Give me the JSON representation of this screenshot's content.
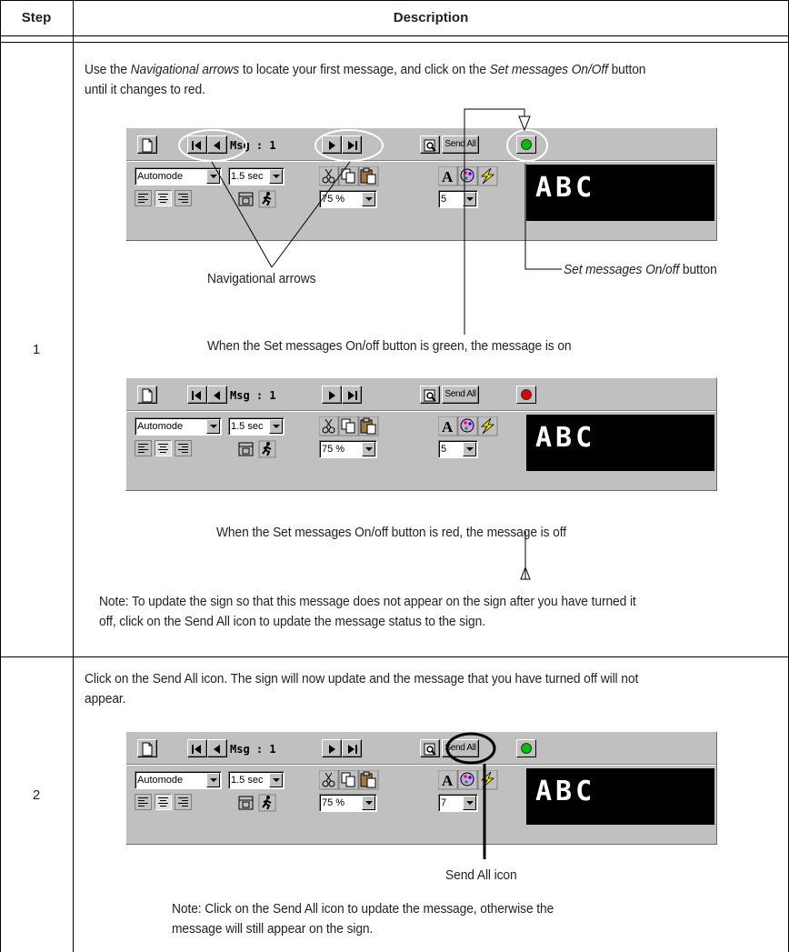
{
  "table": {
    "col_step": "Step",
    "col_description": "Description"
  },
  "step1": {
    "number": "1",
    "intro_prefix": "Use the ",
    "intro_nav": "Navigational arrows",
    "intro_mid": " to locate your first message, and click on the ",
    "intro_btn": "Set messages On/Off",
    "intro_suffix": " button",
    "intro_line2": "until it changes to red.",
    "callout_nav": "Navigational arrows",
    "callout_btn_italic": "Set messages On/off",
    "callout_btn_rest": " button",
    "caption_green": "When the Set messages On/off button is green, the message is on",
    "caption_red": "When the Set messages On/off button is red, the message is off",
    "note_line1": "Note: To update the sign so that this message does not appear on the sign after you have turned it",
    "note_line2": "off, click on the Send All icon to update the message status to the sign."
  },
  "step2": {
    "number": "2",
    "intro_line1": "Click on the Send All icon. The sign will now update and the message that you have turned off will not",
    "intro_line2": "appear.",
    "callout_send": "Send All icon",
    "note_line1": "Note: Click on the Send All icon to update the message, otherwise the",
    "note_line2": "message will still appear on the sign."
  },
  "toolbars": [
    {
      "msg_label": "Msg : 1",
      "send_all": "Send All",
      "led_color": "#00c000",
      "mode": "Automode",
      "duration": "1.5 sec",
      "zoom": "75 %",
      "size": "5",
      "display_text": "ABC"
    },
    {
      "msg_label": "Msg : 1",
      "send_all": "Send All",
      "led_color": "#e00000",
      "mode": "Automode",
      "duration": "1.5 sec",
      "zoom": "75 %",
      "size": "5",
      "display_text": "ABC"
    },
    {
      "msg_label": "Msg : 1",
      "send_all": "Send All",
      "led_color": "#00c000",
      "mode": "Automode",
      "duration": "1.5 sec",
      "zoom": "75 %",
      "size": "7",
      "display_text": "ABC"
    }
  ]
}
